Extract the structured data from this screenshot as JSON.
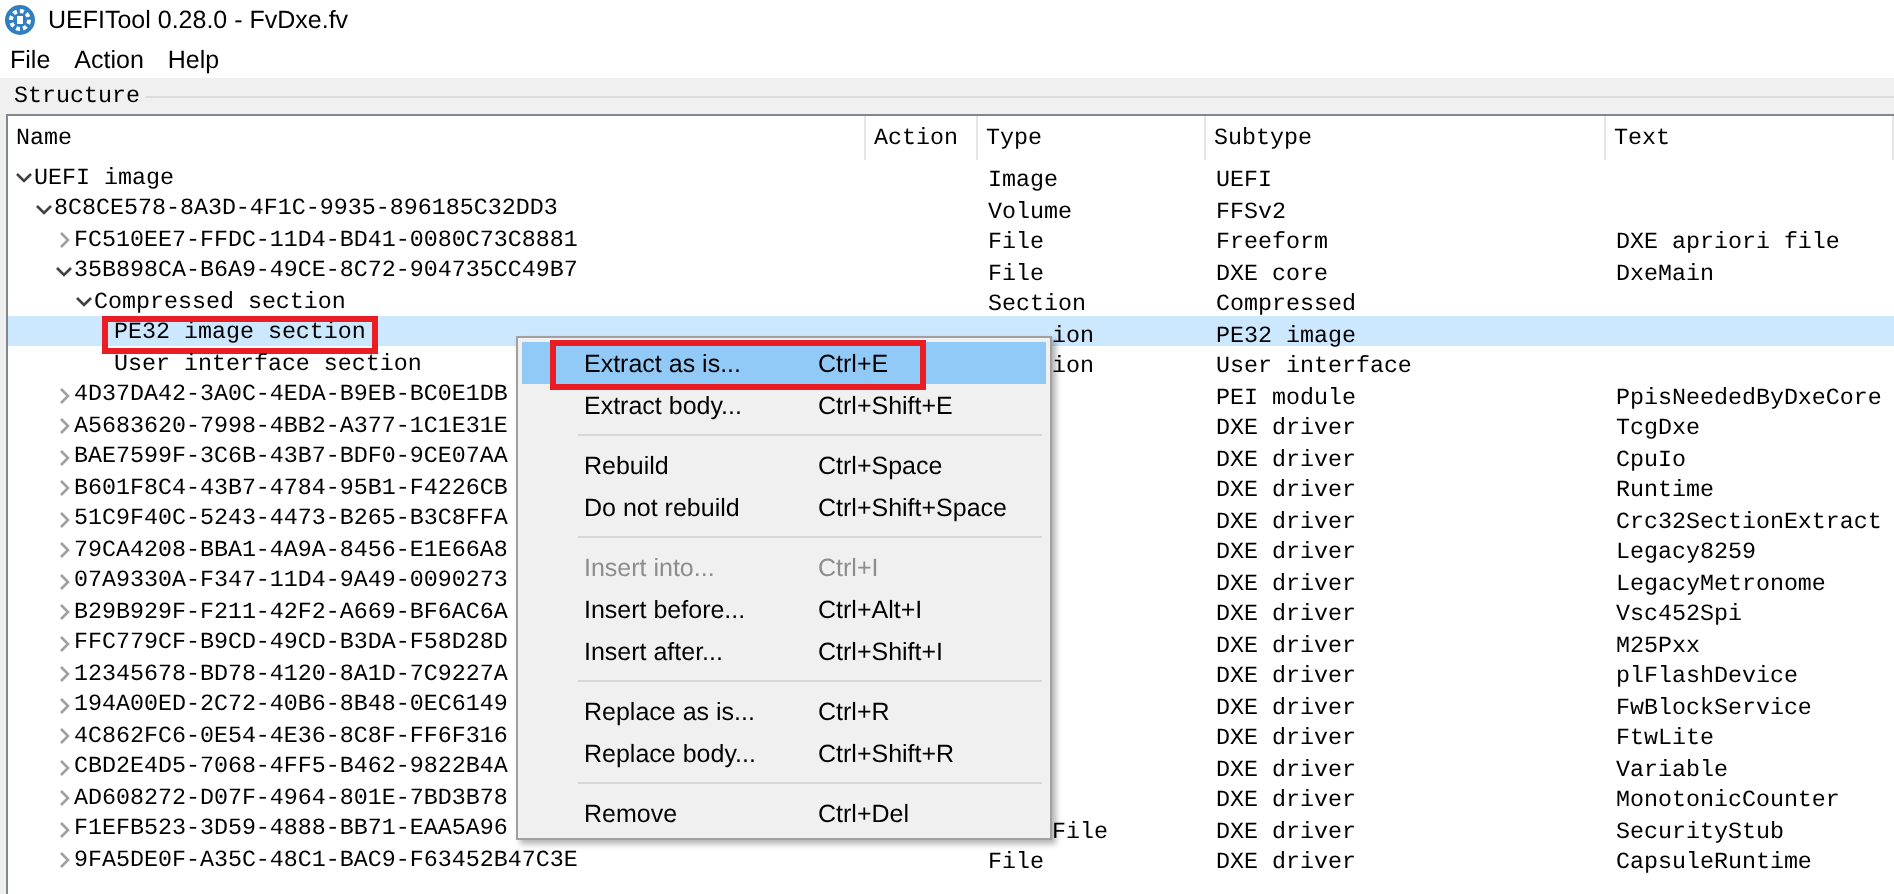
{
  "window": {
    "title": "UEFITool 0.28.0 - FvDxe.fv"
  },
  "menu_bar": [
    {
      "label": "File"
    },
    {
      "label": "Action"
    },
    {
      "label": "Help"
    }
  ],
  "structure": {
    "title": "Structure",
    "columns": [
      "Name",
      "Action",
      "Type",
      "Subtype",
      "Text"
    ],
    "tree": [
      {
        "name": "UEFI image",
        "type": "Image",
        "subtype": "UEFI",
        "expanded": true,
        "selected": false,
        "children": [
          {
            "name": "8C8CE578-8A3D-4F1C-9935-896185C32DD3",
            "type": "Volume",
            "subtype": "FFSv2",
            "expanded": true,
            "selected": false,
            "children": [
              {
                "name": "FC510EE7-FFDC-11D4-BD41-0080C73C8881",
                "type": "File",
                "subtype": "Freeform",
                "text": "DXE apriori file",
                "expanded": false,
                "selected": false
              },
              {
                "name": "35B898CA-B6A9-49CE-8C72-904735CC49B7",
                "type": "File",
                "subtype": "DXE core",
                "text": "DxeMain",
                "expanded": true,
                "selected": false,
                "children": [
                  {
                    "name": "Compressed section",
                    "type": "Section",
                    "subtype": "Compressed",
                    "expanded": true,
                    "selected": false,
                    "children": [
                      {
                        "name": "PE32 image section",
                        "type": "ion",
                        "subtype": "PE32 image",
                        "selected": true,
                        "framed": true
                      },
                      {
                        "name": "User interface section",
                        "type": "ion",
                        "subtype": "User interface",
                        "selected": false
                      }
                    ]
                  }
                ]
              },
              {
                "name": "4D37DA42-3A0C-4EDA-B9EB-BC0E1DB",
                "subtype": "PEI module",
                "text": "PpisNeededByDxeCore",
                "expanded": false,
                "selected": false
              },
              {
                "name": "A5683620-7998-4BB2-A377-1C1E31E",
                "subtype": "DXE driver",
                "text": "TcgDxe",
                "expanded": false,
                "selected": false
              },
              {
                "name": "BAE7599F-3C6B-43B7-BDF0-9CE07AA",
                "subtype": "DXE driver",
                "text": "CpuIo",
                "expanded": false,
                "selected": false
              },
              {
                "name": "B601F8C4-43B7-4784-95B1-F4226CB",
                "subtype": "DXE driver",
                "text": "Runtime",
                "expanded": false,
                "selected": false
              },
              {
                "name": "51C9F40C-5243-4473-B265-B3C8FFA",
                "subtype": "DXE driver",
                "text": "Crc32SectionExtract",
                "expanded": false,
                "selected": false
              },
              {
                "name": "79CA4208-BBA1-4A9A-8456-E1E66A8",
                "subtype": "DXE driver",
                "text": "Legacy8259",
                "expanded": false,
                "selected": false
              },
              {
                "name": "07A9330A-F347-11D4-9A49-0090273",
                "subtype": "DXE driver",
                "text": "LegacyMetronome",
                "expanded": false,
                "selected": false
              },
              {
                "name": "B29B929F-F211-42F2-A669-BF6AC6A",
                "subtype": "DXE driver",
                "text": "Vsc452Spi",
                "expanded": false,
                "selected": false
              },
              {
                "name": "FFC779CF-B9CD-49CD-B3DA-F58D28D",
                "subtype": "DXE driver",
                "text": "M25Pxx",
                "expanded": false,
                "selected": false
              },
              {
                "name": "12345678-BD78-4120-8A1D-7C9227A",
                "subtype": "DXE driver",
                "text": "plFlashDevice",
                "expanded": false,
                "selected": false
              },
              {
                "name": "194A00ED-2C72-40B6-8B48-0EC6149",
                "subtype": "DXE driver",
                "text": "FwBlockService",
                "expanded": false,
                "selected": false
              },
              {
                "name": "4C862FC6-0E54-4E36-8C8F-FF6F316",
                "subtype": "DXE driver",
                "text": "FtwLite",
                "expanded": false,
                "selected": false
              },
              {
                "name": "CBD2E4D5-7068-4FF5-B462-9822B4A",
                "subtype": "DXE driver",
                "text": "Variable",
                "expanded": false,
                "selected": false
              },
              {
                "name": "AD608272-D07F-4964-801E-7BD3B78",
                "subtype": "DXE driver",
                "text": "MonotonicCounter",
                "expanded": false,
                "selected": false
              },
              {
                "name": "F1EFB523-3D59-4888-BB71-EAA5A96",
                "type": "File",
                "subtype": "DXE driver",
                "text": "SecurityStub",
                "expanded": false,
                "selected": false
              },
              {
                "name": "9FA5DE0F-A35C-48C1-BAC9-F63452B47C3E",
                "type": "File",
                "subtype": "DXE driver",
                "text": "CapsuleRuntime",
                "expanded": false,
                "selected": false
              }
            ]
          }
        ]
      }
    ]
  },
  "context_menu": {
    "items": [
      {
        "kind": "item",
        "label": "Extract as is...",
        "shortcut": "Ctrl+E",
        "selected": true,
        "disabled": false,
        "framed": true
      },
      {
        "kind": "item",
        "label": "Extract body...",
        "shortcut": "Ctrl+Shift+E",
        "selected": false,
        "disabled": false
      },
      {
        "kind": "separator"
      },
      {
        "kind": "item",
        "label": "Rebuild",
        "shortcut": "Ctrl+Space",
        "selected": false,
        "disabled": false
      },
      {
        "kind": "item",
        "label": "Do not rebuild",
        "shortcut": "Ctrl+Shift+Space",
        "selected": false,
        "disabled": false
      },
      {
        "kind": "separator"
      },
      {
        "kind": "item",
        "label": "Insert into...",
        "shortcut": "Ctrl+I",
        "selected": false,
        "disabled": true
      },
      {
        "kind": "item",
        "label": "Insert before...",
        "shortcut": "Ctrl+Alt+I",
        "selected": false,
        "disabled": false
      },
      {
        "kind": "item",
        "label": "Insert after...",
        "shortcut": "Ctrl+Shift+I",
        "selected": false,
        "disabled": false
      },
      {
        "kind": "separator"
      },
      {
        "kind": "item",
        "label": "Replace as is...",
        "shortcut": "Ctrl+R",
        "selected": false,
        "disabled": false
      },
      {
        "kind": "item",
        "label": "Replace body...",
        "shortcut": "Ctrl+Shift+R",
        "selected": false,
        "disabled": false
      },
      {
        "kind": "separator"
      },
      {
        "kind": "item",
        "label": "Remove",
        "shortcut": "Ctrl+Del",
        "selected": false,
        "disabled": false
      }
    ]
  }
}
